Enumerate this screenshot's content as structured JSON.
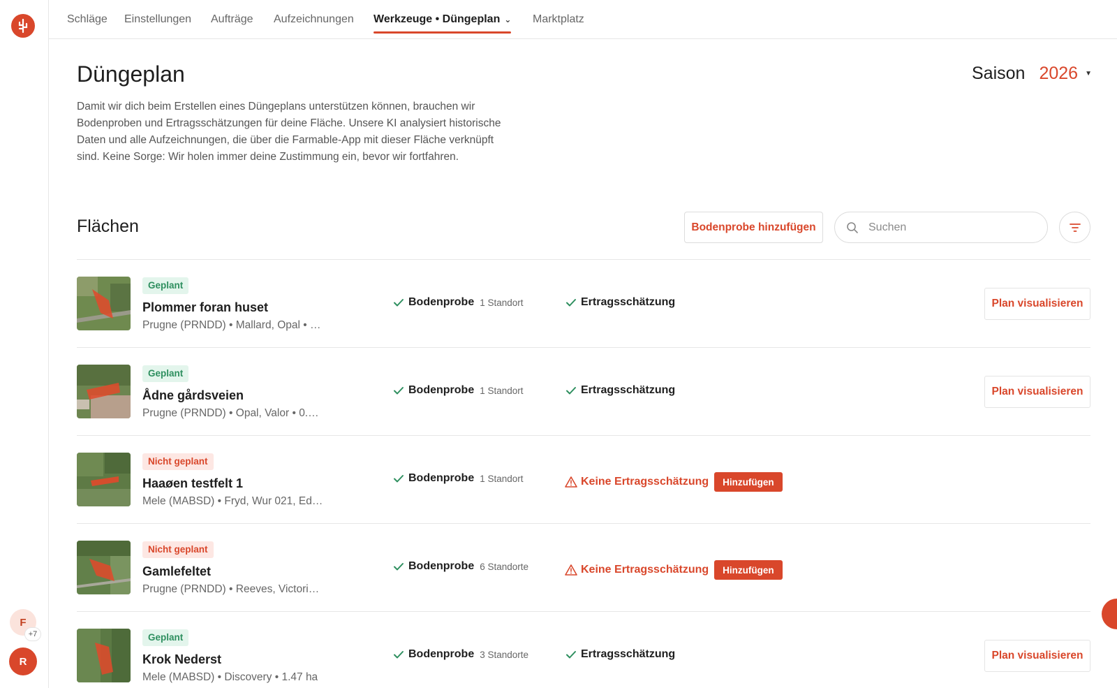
{
  "colors": {
    "accent": "#d9472b",
    "planned_bg": "#e3f5ec",
    "planned_text": "#2e8f5f",
    "notplanned_bg": "#fde7e3"
  },
  "nav": {
    "items": [
      {
        "label": "Schläge"
      },
      {
        "label": "Einstellungen"
      },
      {
        "label": "Aufträge"
      },
      {
        "label": "Aufzeichnungen"
      },
      {
        "label": "Werkzeuge • Düngeplan",
        "active": true
      },
      {
        "label": "Marktplatz"
      }
    ]
  },
  "sidebar": {
    "logo_icon": "farmable-logo-icon",
    "avatars": [
      {
        "initial": "F"
      },
      {
        "initial": "R"
      }
    ],
    "more_count": "+7"
  },
  "page": {
    "title": "Düngeplan",
    "intro": "Damit wir dich beim Erstellen eines Düngeplans unterstützen können, brauchen wir Bodenproben und Ertragsschätzungen für deine Fläche. Unsere KI analysiert historische Daten und alle Aufzeichnungen, die über die Farmable-App mit dieser Fläche verknüpft sind. Keine Sorge: Wir holen immer deine Zustimmung ein, bevor wir fortfahren.",
    "season_label": "Saison",
    "season_value": "2026"
  },
  "fields_section": {
    "title": "Flächen",
    "add_soil_label": "Bodenprobe hinzufügen",
    "search_placeholder": "Suchen",
    "search_value": "",
    "filter_icon": "filter-icon"
  },
  "fields": [
    {
      "status": "Geplant",
      "planned": true,
      "name": "Plommer foran huset",
      "meta": "Prugne (PRNDD) • Mallard, Opal • …",
      "soil_label": "Bodenprobe",
      "soil_count": "1 Standort",
      "yield_label": "Ertragsschätzung",
      "yield_ok": true,
      "action_label": "Plan visualisieren"
    },
    {
      "status": "Geplant",
      "planned": true,
      "name": "Ådne gårdsveien",
      "meta": "Prugne (PRNDD) • Opal, Valor • 0.…",
      "soil_label": "Bodenprobe",
      "soil_count": "1 Standort",
      "yield_label": "Ertragsschätzung",
      "yield_ok": true,
      "action_label": "Plan visualisieren"
    },
    {
      "status": "Nicht geplant",
      "planned": false,
      "name": "Haaøen testfelt 1",
      "meta": "Mele (MABSD) • Fryd, Wur 021, Ed…",
      "soil_label": "Bodenprobe",
      "soil_count": "1 Standort",
      "yield_label": "Keine Ertragsschätzung",
      "yield_ok": false,
      "add_label": "Hinzufügen"
    },
    {
      "status": "Nicht geplant",
      "planned": false,
      "name": "Gamlefeltet",
      "meta": "Prugne (PRNDD) • Reeves, Victori…",
      "soil_label": "Bodenprobe",
      "soil_count": "6 Standorte",
      "yield_label": "Keine Ertragsschätzung",
      "yield_ok": false,
      "add_label": "Hinzufügen"
    },
    {
      "status": "Geplant",
      "planned": true,
      "name": "Krok Nederst",
      "meta": "Mele (MABSD) • Discovery • 1.47 ha",
      "soil_label": "Bodenprobe",
      "soil_count": "3 Standorte",
      "yield_label": "Ertragsschätzung",
      "yield_ok": true,
      "action_label": "Plan visualisieren"
    }
  ]
}
